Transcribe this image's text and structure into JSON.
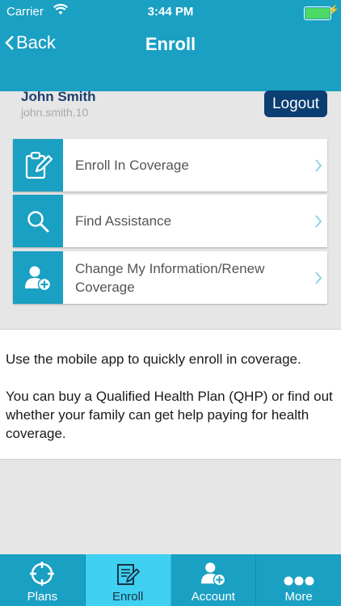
{
  "status_bar": {
    "carrier": "Carrier",
    "time": "3:44 PM"
  },
  "nav": {
    "back_label": "Back",
    "title": "Enroll"
  },
  "user": {
    "name": "John Smith",
    "username": "john.smith.10",
    "logout_label": "Logout"
  },
  "menu": [
    {
      "label": "Enroll In Coverage",
      "icon": "clipboard-edit-icon"
    },
    {
      "label": "Find Assistance",
      "icon": "search-icon"
    },
    {
      "label": "Change My Information/Renew Coverage",
      "icon": "user-add-icon"
    }
  ],
  "info": {
    "paragraph1": "Use the mobile app to quickly enroll in coverage.",
    "paragraph2": "You can buy a Qualified Health Plan (QHP) or find out whether your family can get help paying for health coverage."
  },
  "tabs": [
    {
      "label": "Plans",
      "icon": "crosshair-icon"
    },
    {
      "label": "Enroll",
      "icon": "edit-document-icon",
      "active": true
    },
    {
      "label": "Account",
      "icon": "user-add-icon"
    },
    {
      "label": "More",
      "icon": "more-dots-icon"
    }
  ],
  "colors": {
    "primary": "#1aa0c3",
    "active_tab": "#3fd0f2",
    "logout_button": "#0b3e72",
    "user_name": "#1b3f6e"
  }
}
